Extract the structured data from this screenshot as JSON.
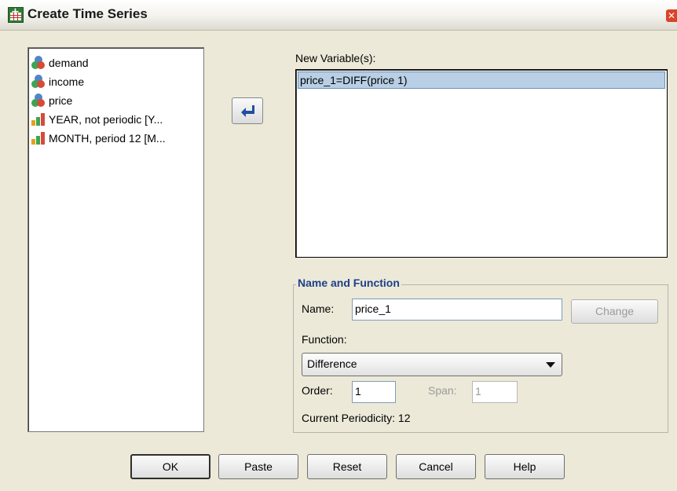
{
  "window": {
    "title": "Create Time Series",
    "close_glyph": "✕"
  },
  "source_list": {
    "items": [
      {
        "label": "demand",
        "icon": "scale-variable-icon"
      },
      {
        "label": "income",
        "icon": "scale-variable-icon"
      },
      {
        "label": "price",
        "icon": "scale-variable-icon"
      },
      {
        "label": "YEAR, not periodic [Y...",
        "icon": "date-variable-icon"
      },
      {
        "label": "MONTH, period 12 [M...",
        "icon": "date-variable-icon"
      }
    ]
  },
  "new_variables": {
    "label": "New Variable(s):",
    "items": [
      "price_1=DIFF(price 1)"
    ]
  },
  "name_function": {
    "group_title": "Name and Function",
    "name_label": "Name:",
    "name_value": "price_1",
    "change_button": "Change",
    "function_label": "Function:",
    "function_value": "Difference",
    "order_label": "Order:",
    "order_value": "1",
    "span_label": "Span:",
    "span_value": "1",
    "periodicity_text": "Current Periodicity: 12"
  },
  "buttons": {
    "ok": "OK",
    "paste": "Paste",
    "reset": "Reset",
    "cancel": "Cancel",
    "help": "Help"
  },
  "colors": {
    "selection": "#b8cfe5",
    "group_title": "#1e3f8a",
    "dialog_bg": "#ece9d8"
  }
}
